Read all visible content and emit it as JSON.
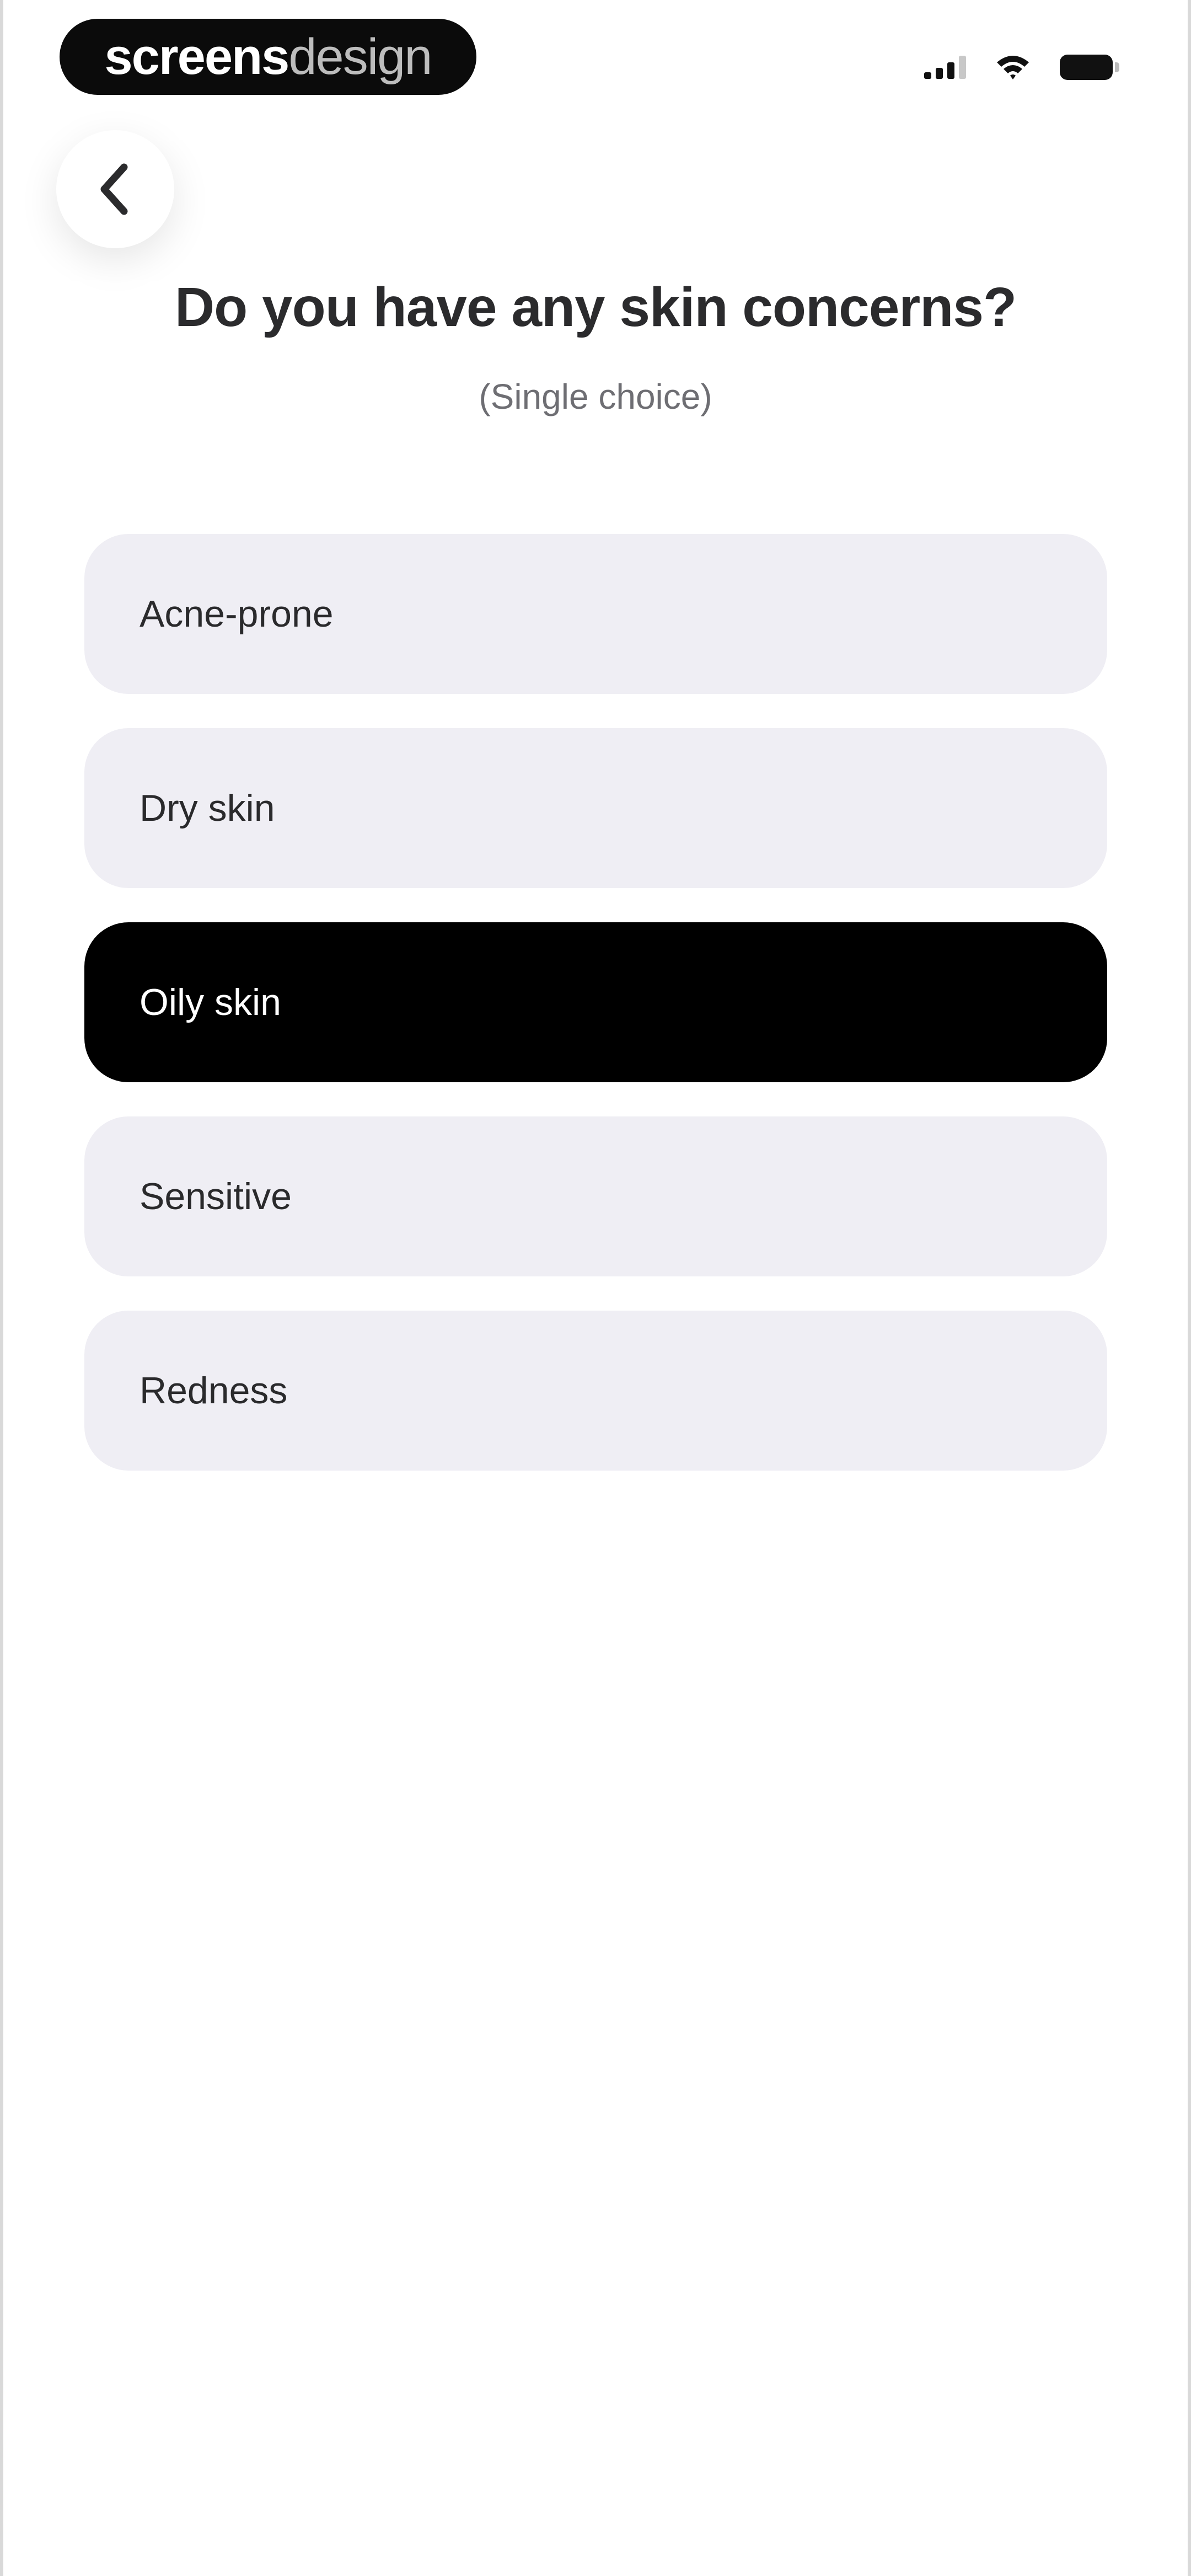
{
  "status_bar": {
    "brand_strong": "screens",
    "brand_light": "design",
    "icons": [
      "signal-icon",
      "wifi-icon",
      "battery-icon"
    ]
  },
  "header": {
    "back_icon": "chevron-left-icon"
  },
  "question": {
    "title": "Do you have any skin concerns?",
    "subtitle": "(Single choice)"
  },
  "options": [
    {
      "label": "Acne-prone",
      "selected": false
    },
    {
      "label": "Dry skin",
      "selected": false
    },
    {
      "label": "Oily skin",
      "selected": true
    },
    {
      "label": "Sensitive",
      "selected": false
    },
    {
      "label": "Redness",
      "selected": false
    }
  ],
  "colors": {
    "option_bg": "#efeef4",
    "selected_bg": "#000000",
    "selected_text": "#ffffff"
  }
}
